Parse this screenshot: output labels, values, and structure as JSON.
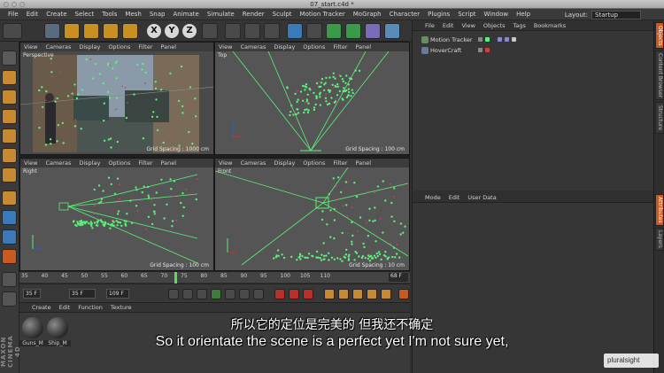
{
  "window": {
    "title": "07_start.c4d *"
  },
  "menubar": {
    "items": [
      "File",
      "Edit",
      "Create",
      "Select",
      "Tools",
      "Mesh",
      "Snap",
      "Animate",
      "Simulate",
      "Render",
      "Sculpt",
      "Motion Tracker",
      "MoGraph",
      "Character",
      "Plugins",
      "Script",
      "Window",
      "Help"
    ],
    "layout_label": "Layout:",
    "layout_value": "Startup"
  },
  "toolbar": {
    "axis_x": "X",
    "axis_y": "Y",
    "axis_z": "Z"
  },
  "viewport_menu": [
    "View",
    "Cameras",
    "Display",
    "Options",
    "Filter",
    "Panel"
  ],
  "viewports": {
    "perspective": {
      "name": "Perspective",
      "grid": "Grid Spacing : 1000 cm"
    },
    "top": {
      "name": "Top",
      "grid": "Grid Spacing : 100 cm"
    },
    "right": {
      "name": "Right",
      "grid": "Grid Spacing : 100 cm"
    },
    "front": {
      "name": "Front",
      "grid": "Grid Spacing : 10 cm"
    }
  },
  "timeline": {
    "ticks": [
      "35",
      "40",
      "45",
      "50",
      "55",
      "60",
      "65",
      "70",
      "75",
      "80",
      "85",
      "90",
      "95",
      "100",
      "105",
      "110"
    ],
    "current_frame": "68",
    "end_field": "68 F"
  },
  "transport": {
    "start": "35 F",
    "preview_start": "35 F",
    "end": "109 F"
  },
  "material_manager": {
    "menu": [
      "Create",
      "Edit",
      "Function",
      "Texture"
    ],
    "materials": [
      "Guns_M",
      "Ship_M"
    ]
  },
  "object_manager": {
    "menu": [
      "File",
      "Edit",
      "View",
      "Objects",
      "Tags",
      "Bookmarks"
    ],
    "objects": [
      "Motion Tracker",
      "HoverCraft"
    ]
  },
  "attribute_manager": {
    "menu": [
      "Mode",
      "Edit",
      "User Data"
    ]
  },
  "right_tabs": [
    "Objects",
    "Content Browser",
    "Structure",
    "Attributes",
    "Layers"
  ],
  "brand": {
    "maxon": "MAXON CINEMA 4D",
    "pluralsight": "pluralsight"
  },
  "subtitles": {
    "zh": "所以它的定位是完美的 但我还不确定",
    "en": "So it orientate the scene is a perfect yet I'm not sure yet,"
  },
  "colors": {
    "track_green": "#5cf07a",
    "track_red": "#d04060",
    "accent_orange": "#c85a20"
  }
}
